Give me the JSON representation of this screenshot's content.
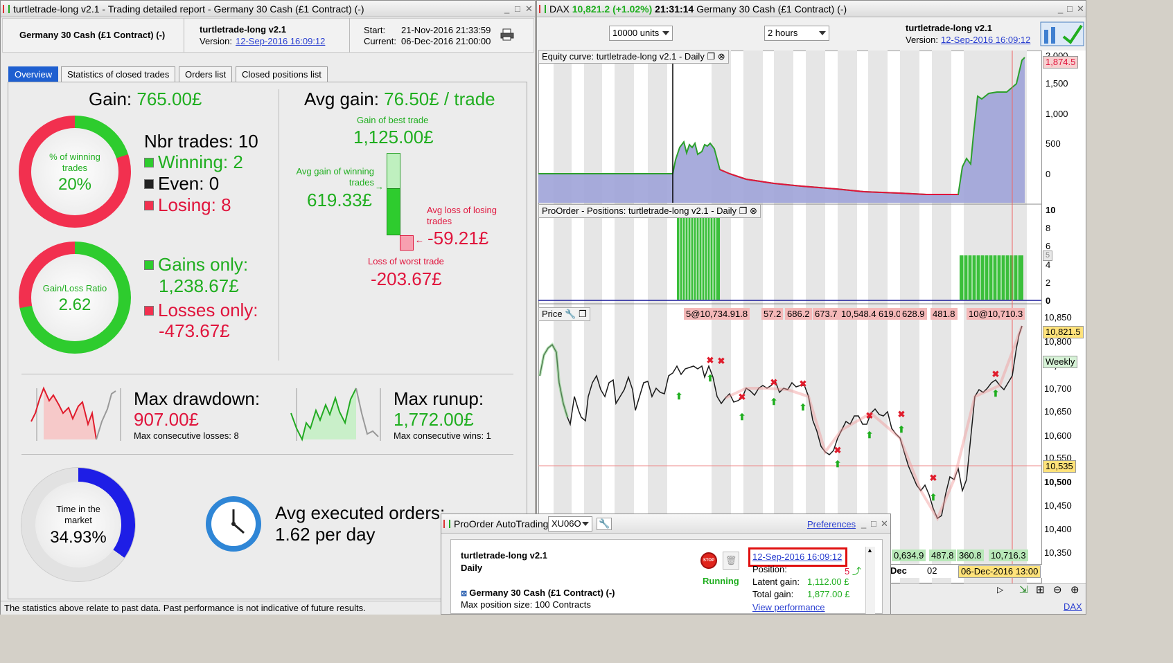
{
  "left_window": {
    "title": "turtletrade-long v2.1 - Trading detailed report - Germany 30 Cash (£1 Contract) (-)",
    "instrument": "Germany 30 Cash (£1 Contract) (-)",
    "strategy_name": "turtletrade-long v2.1",
    "version_label": "Version:",
    "version_link": "12-Sep-2016 16:09:12",
    "start_label": "Start:",
    "start_value": "21-Nov-2016 21:33:59",
    "current_label": "Current:",
    "current_value": "06-Dec-2016 21:00:00",
    "tabs": [
      "Overview",
      "Statistics of closed trades",
      "Orders list",
      "Closed positions list"
    ],
    "gain_label": "Gain:",
    "gain_value": "765.00£",
    "winning_donut_label": "% of winning trades",
    "winning_donut_value": "20%",
    "winning_fraction": 0.2,
    "nbr_trades": "Nbr trades: 10",
    "winning": "Winning: 2",
    "even": "Even: 0",
    "losing": "Losing: 8",
    "ratio_donut_label": "Gain/Loss Ratio",
    "ratio_donut_value": "2.62",
    "gains_only_label": "Gains only:",
    "gains_only_value": "1,238.67£",
    "losses_only_label": "Losses only:",
    "losses_only_value": "-473.67£",
    "avg_gain_label": "Avg gain:",
    "avg_gain_value": "76.50£ / trade",
    "best_trade_label": "Gain of best trade",
    "best_trade_value": "1,125.00£",
    "avg_winning_label": "Avg gain of winning trades",
    "avg_winning_value": "619.33£",
    "avg_losing_label": "Avg loss of losing trades",
    "avg_losing_value": "-59.21£",
    "worst_trade_label": "Loss of worst trade",
    "worst_trade_value": "-203.67£",
    "max_drawdown_label": "Max drawdown:",
    "max_drawdown_value": "907.00£",
    "max_consec_losses": "Max consecutive losses: 8",
    "max_runup_label": "Max runup:",
    "max_runup_value": "1,772.00£",
    "max_consec_wins": "Max consecutive wins: 1",
    "time_market_label": "Time in the market",
    "time_market_value": "34.93%",
    "time_market_fraction": 0.3493,
    "avg_orders_label": "Avg executed orders:",
    "avg_orders_value": "1.62 per day",
    "footer_note": "The statistics above relate to past data. Past performance is not indicative of future results."
  },
  "right_window": {
    "title_prefix": "DAX",
    "title_price": "10,821.2 (+1.02%)",
    "title_time": "21:31:14",
    "title_instrument": "Germany 30 Cash (£1 Contract) (-)",
    "units_select": "10000 units",
    "period_select": "2 hours",
    "strategy_name": "turtletrade-long v2.1",
    "version_label": "Version:",
    "version_link": "12-Sep-2016 16:09:12",
    "equity_panel_label": "Equity curve: turtletrade-long v2.1 - Daily",
    "equity_axis": [
      "2,000",
      "1,500",
      "1,000",
      "500",
      "0"
    ],
    "equity_current": "1,874.5",
    "positions_panel_label": "ProOrder - Positions: turtletrade-long v2.1 - Daily",
    "positions_axis": [
      "10",
      "8",
      "6",
      "4",
      "2",
      "0"
    ],
    "positions_marker": "5",
    "price_panel_label": "Price",
    "price_axis": [
      "10,850",
      "10,800",
      "10,750",
      "10,700",
      "10,650",
      "10,600",
      "10,550",
      "10,500",
      "10,450",
      "10,400",
      "10,350"
    ],
    "price_current": "10,821.5",
    "price_line": "10,535",
    "weekly_label": "Weekly",
    "top_labels": [
      "5@10,734.91.8",
      "57.2",
      "686.2",
      "673.7",
      "10,548.4",
      "619.0",
      "628.9",
      "481.8",
      "10@10,710.3"
    ],
    "bottom_labels": [
      "0,634.9",
      "487.8",
      "360.8",
      "10,716.3"
    ],
    "xaxis_labels": [
      "Dec",
      "02"
    ],
    "xaxis_highlight": "06-Dec-2016 13:00",
    "status_dax": "DAX"
  },
  "proorder": {
    "title": "ProOrder AutoTrading",
    "account": "XU06O",
    "preferences_link": "Preferences",
    "strategy_name": "turtletrade-long v2.1",
    "timeframe": "Daily",
    "instrument": "Germany 30 Cash (£1 Contract) (-)",
    "max_position": "Max position size: 100 Contracts",
    "status": "Running",
    "stop_label": "STOP",
    "version_link": "12-Sep-2016 16:09:12",
    "position_label": "Position:",
    "position_value": "5",
    "latent_gain_label": "Latent gain:",
    "latent_gain_value": "1,112.00 £",
    "total_gain_label": "Total gain:",
    "total_gain_value": "1,877.00 £",
    "view_performance": "View performance"
  },
  "colors": {
    "green": "#1fae1f",
    "red": "#e0143c",
    "blue": "#1e1ee6",
    "tab_active": "#1e5fd0"
  }
}
